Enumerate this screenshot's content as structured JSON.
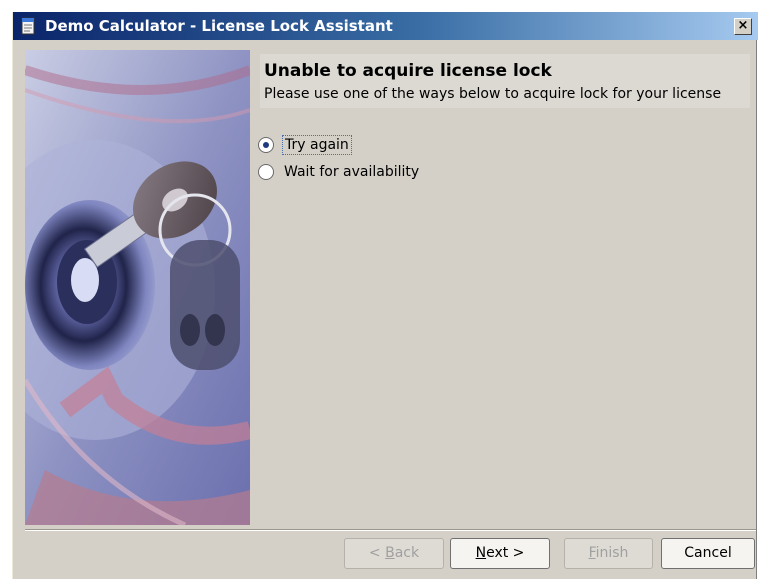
{
  "window": {
    "title": "Demo Calculator - License Lock Assistant",
    "close_label": "×"
  },
  "header": {
    "title": "Unable to acquire license lock",
    "subtitle": "Please use one of the ways below to acquire lock for your license"
  },
  "options": [
    {
      "label": "Try again",
      "selected": true
    },
    {
      "label": "Wait for availability",
      "selected": false
    }
  ],
  "buttons": {
    "back": {
      "prefix": "< ",
      "mnemonic": "B",
      "rest": "ack",
      "enabled": false
    },
    "next": {
      "mnemonic": "N",
      "rest": "ext >",
      "enabled": true
    },
    "finish": {
      "mnemonic": "F",
      "rest": "inish",
      "enabled": false
    },
    "cancel": {
      "label": "Cancel",
      "enabled": true
    }
  },
  "icons": {
    "window_icon": "document-icon",
    "side_image": "key-illustration"
  },
  "colors": {
    "titlebar_start": "#0a246a",
    "titlebar_end": "#a6caf0",
    "dialog_bg": "#d4d0c8",
    "radio_dot": "#1f3a80"
  }
}
